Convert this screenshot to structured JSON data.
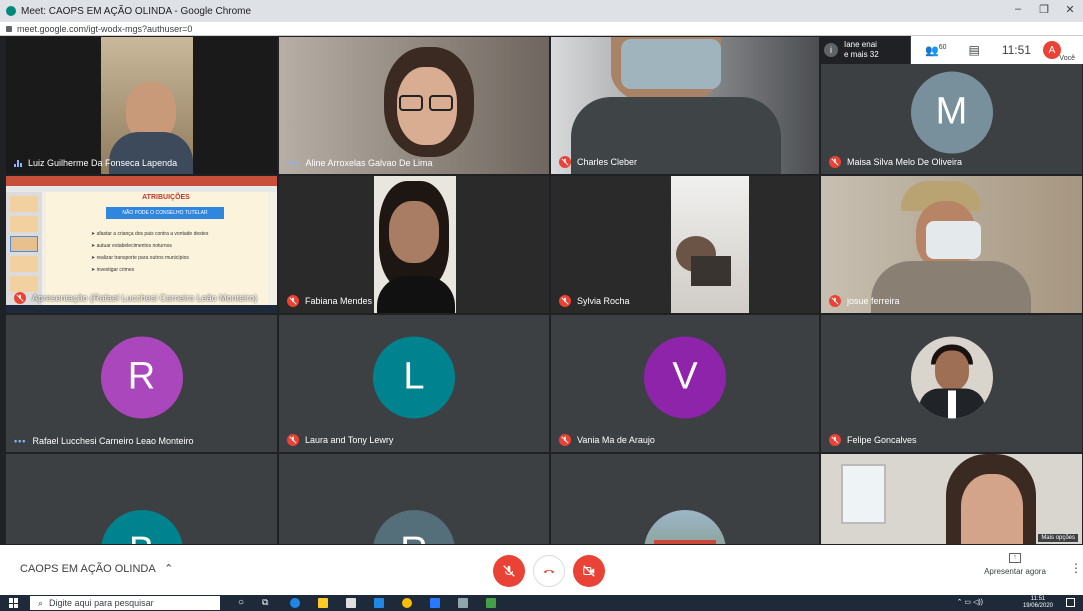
{
  "browser": {
    "tab_title": "Meet: CAOPS EM AÇÃO OLINDA - Google Chrome",
    "url": "meet.google.com/igt-wodx-mgs?authuser=0",
    "minimize": "–",
    "maximize": "❐",
    "close": "✕"
  },
  "meet": {
    "info_text": "Iane enai e mais 32",
    "info_line1": "Iane enai",
    "info_line2": "e mais 32",
    "participant_count": "60",
    "time": "11:51",
    "you_label": "Você",
    "you_initial": "A",
    "more_options_label": "Mais opções",
    "participants": [
      {
        "name": "Luiz Guilherme Da Fonseca Lapenda",
        "status": "speaking"
      },
      {
        "name": "Aline Arroxelas Galvao De Lima",
        "status": "dots"
      },
      {
        "name": "Charles Cleber",
        "status": "muted"
      },
      {
        "name": "Maisa Silva Melo De Oliveira",
        "status": "muted",
        "initial": "M"
      },
      {
        "name": "Apresentação (Rafael Lucchesi Carneiro Leão Monteiro)",
        "status": "muted"
      },
      {
        "name": "Fabiana Mendes",
        "status": "muted"
      },
      {
        "name": "Sylvia Rocha",
        "status": "muted"
      },
      {
        "name": "josue ferreira",
        "status": "muted"
      },
      {
        "name": "Rafael Lucchesi Carneiro Leao Monteiro",
        "status": "dots",
        "initial": "R"
      },
      {
        "name": "Laura and Tony Lewry",
        "status": "muted",
        "initial": "L"
      },
      {
        "name": "Vania Ma de Araujo",
        "status": "muted",
        "initial": "V"
      },
      {
        "name": "Felipe Goncalves",
        "status": "muted"
      },
      {
        "initial": "B"
      },
      {
        "initial": "R"
      },
      {},
      {}
    ],
    "slide": {
      "heading": "ATRIBUIÇÕES",
      "box": "NÃO PODE O CONSELHO TUTELAR",
      "bullets": [
        "afastar a criança dos pais contra a vontade destes",
        "autuar estabelecimentos noturnos",
        "realizar transporte para outros municípios",
        "investigar crimes"
      ]
    },
    "colors": {
      "muted_red": "#ea4335",
      "avatar_M": "#78909c",
      "avatar_R": "#ab47bc",
      "avatar_L": "#00838f",
      "avatar_V": "#8e24aa",
      "avatar_B": "#00838f",
      "avatar_R2": "#546e7a"
    }
  },
  "bottom": {
    "meeting_name": "CAOPS EM AÇÃO OLINDA",
    "present_label": "Apresentar agora"
  },
  "taskbar": {
    "search_placeholder": "Digite aqui para pesquisar",
    "clock_time": "11:51",
    "clock_date": "19/06/2020"
  }
}
